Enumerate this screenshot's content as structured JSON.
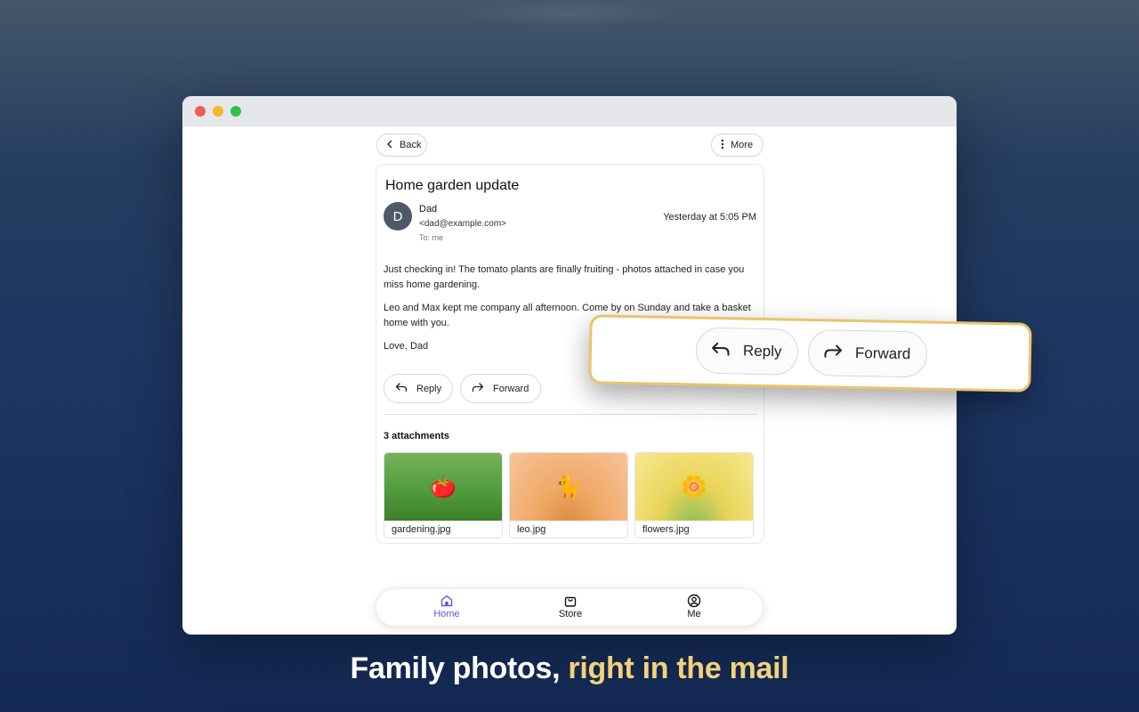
{
  "colors": {
    "accent": "#5b55e0",
    "highlight": "#f4d27a",
    "callout_border": "#e8c56d"
  },
  "window": {
    "controls": [
      "close",
      "minimize",
      "zoom"
    ]
  },
  "toolbar": {
    "back_label": "Back",
    "back_icon": "chevron-left-icon",
    "more_label": "More",
    "more_icon": "vertical-dots-icon"
  },
  "email": {
    "subject": "Home garden update",
    "avatar_initial": "D",
    "sender_name": "Dad",
    "sender_email": "<dad@example.com>",
    "to": "To: me",
    "timestamp": "Yesterday at 5:05 PM",
    "paragraphs": [
      "Just checking in! The tomato plants are finally fruiting - photos attached in case you miss home gardening.",
      "Leo and Max kept me company all afternoon. Come by on Sunday and take a basket home with you.",
      "Love, Dad"
    ],
    "actions": {
      "reply_label": "Reply",
      "forward_label": "Forward"
    },
    "attachments_title": "3 attachments",
    "attachments": [
      {
        "name": "gardening.jpg",
        "emoji": "🍅"
      },
      {
        "name": "leo.jpg",
        "emoji": "🐈"
      },
      {
        "name": "flowers.jpg",
        "emoji": "🌼"
      }
    ]
  },
  "tabs": [
    {
      "label": "Home",
      "icon": "home-icon",
      "active": true
    },
    {
      "label": "Store",
      "icon": "shopping-bag-icon",
      "active": false
    },
    {
      "label": "Me",
      "icon": "user-circle-icon",
      "active": false
    }
  ],
  "callout": {
    "reply_label": "Reply",
    "forward_label": "Forward"
  },
  "caption": {
    "part1": "Family photos, ",
    "part2": "right in the mail"
  }
}
